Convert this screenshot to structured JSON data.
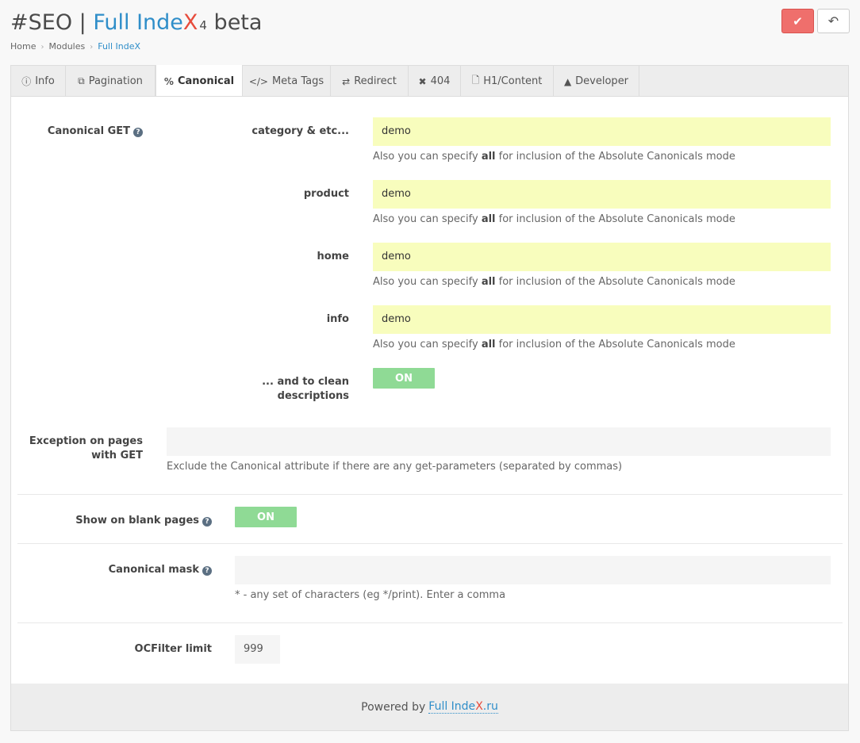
{
  "header": {
    "title_prefix": "#SEO | ",
    "title_brand": "Full Inde",
    "title_brand_x": "X",
    "title_sup": "4",
    "title_suffix": " beta",
    "save_icon": "check-icon",
    "back_icon": "reply-icon"
  },
  "breadcrumb": {
    "items": [
      "Home",
      "Modules",
      "Full IndeX"
    ]
  },
  "tabs": [
    {
      "label": "Info",
      "icon": "info-circle-icon",
      "glyph": "ⓘ"
    },
    {
      "label": "Pagination",
      "icon": "copy-icon",
      "glyph": "⧉"
    },
    {
      "label": "Canonical",
      "icon": "link-icon",
      "glyph": "%"
    },
    {
      "label": "Meta Tags",
      "icon": "code-icon",
      "glyph": "</>"
    },
    {
      "label": "Redirect",
      "icon": "exchange-icon",
      "glyph": "⇄"
    },
    {
      "label": "404",
      "icon": "times-icon",
      "glyph": "✖"
    },
    {
      "label": "H1/Content",
      "icon": "file-icon",
      "glyph": "🗋"
    },
    {
      "label": "Developer",
      "icon": "warning-icon",
      "glyph": "▲"
    }
  ],
  "canonical_get": {
    "label": "Canonical GET",
    "help": "?",
    "hint_pre": "Also you can specify ",
    "hint_bold": "all",
    "hint_post": " for inclusion of the Absolute Canonicals mode",
    "rows": [
      {
        "label": "category & etc...",
        "value": "demo"
      },
      {
        "label": "product",
        "value": "demo"
      },
      {
        "label": "home",
        "value": "demo"
      },
      {
        "label": "info",
        "value": "demo"
      }
    ],
    "clean_label_1": "... and to clean",
    "clean_label_2": "descriptions",
    "clean_toggle": "ON"
  },
  "exception": {
    "label_1": "Exception on pages",
    "label_2": "with GET",
    "value": "",
    "hint": "Exclude the Canonical attribute if there are any get-parameters (separated by commas)"
  },
  "blank_pages": {
    "label": "Show on blank pages",
    "help": "?",
    "toggle": "ON"
  },
  "mask": {
    "label": "Canonical mask",
    "help": "?",
    "value": "",
    "hint": "* - any set of characters (eg */print). Enter a comma"
  },
  "ocfilter": {
    "label": "OCFilter limit",
    "value": "999"
  },
  "footer": {
    "powered": "Powered by",
    "link_text": "Full Inde",
    "link_x": "X",
    "link_suffix": ".ru"
  }
}
